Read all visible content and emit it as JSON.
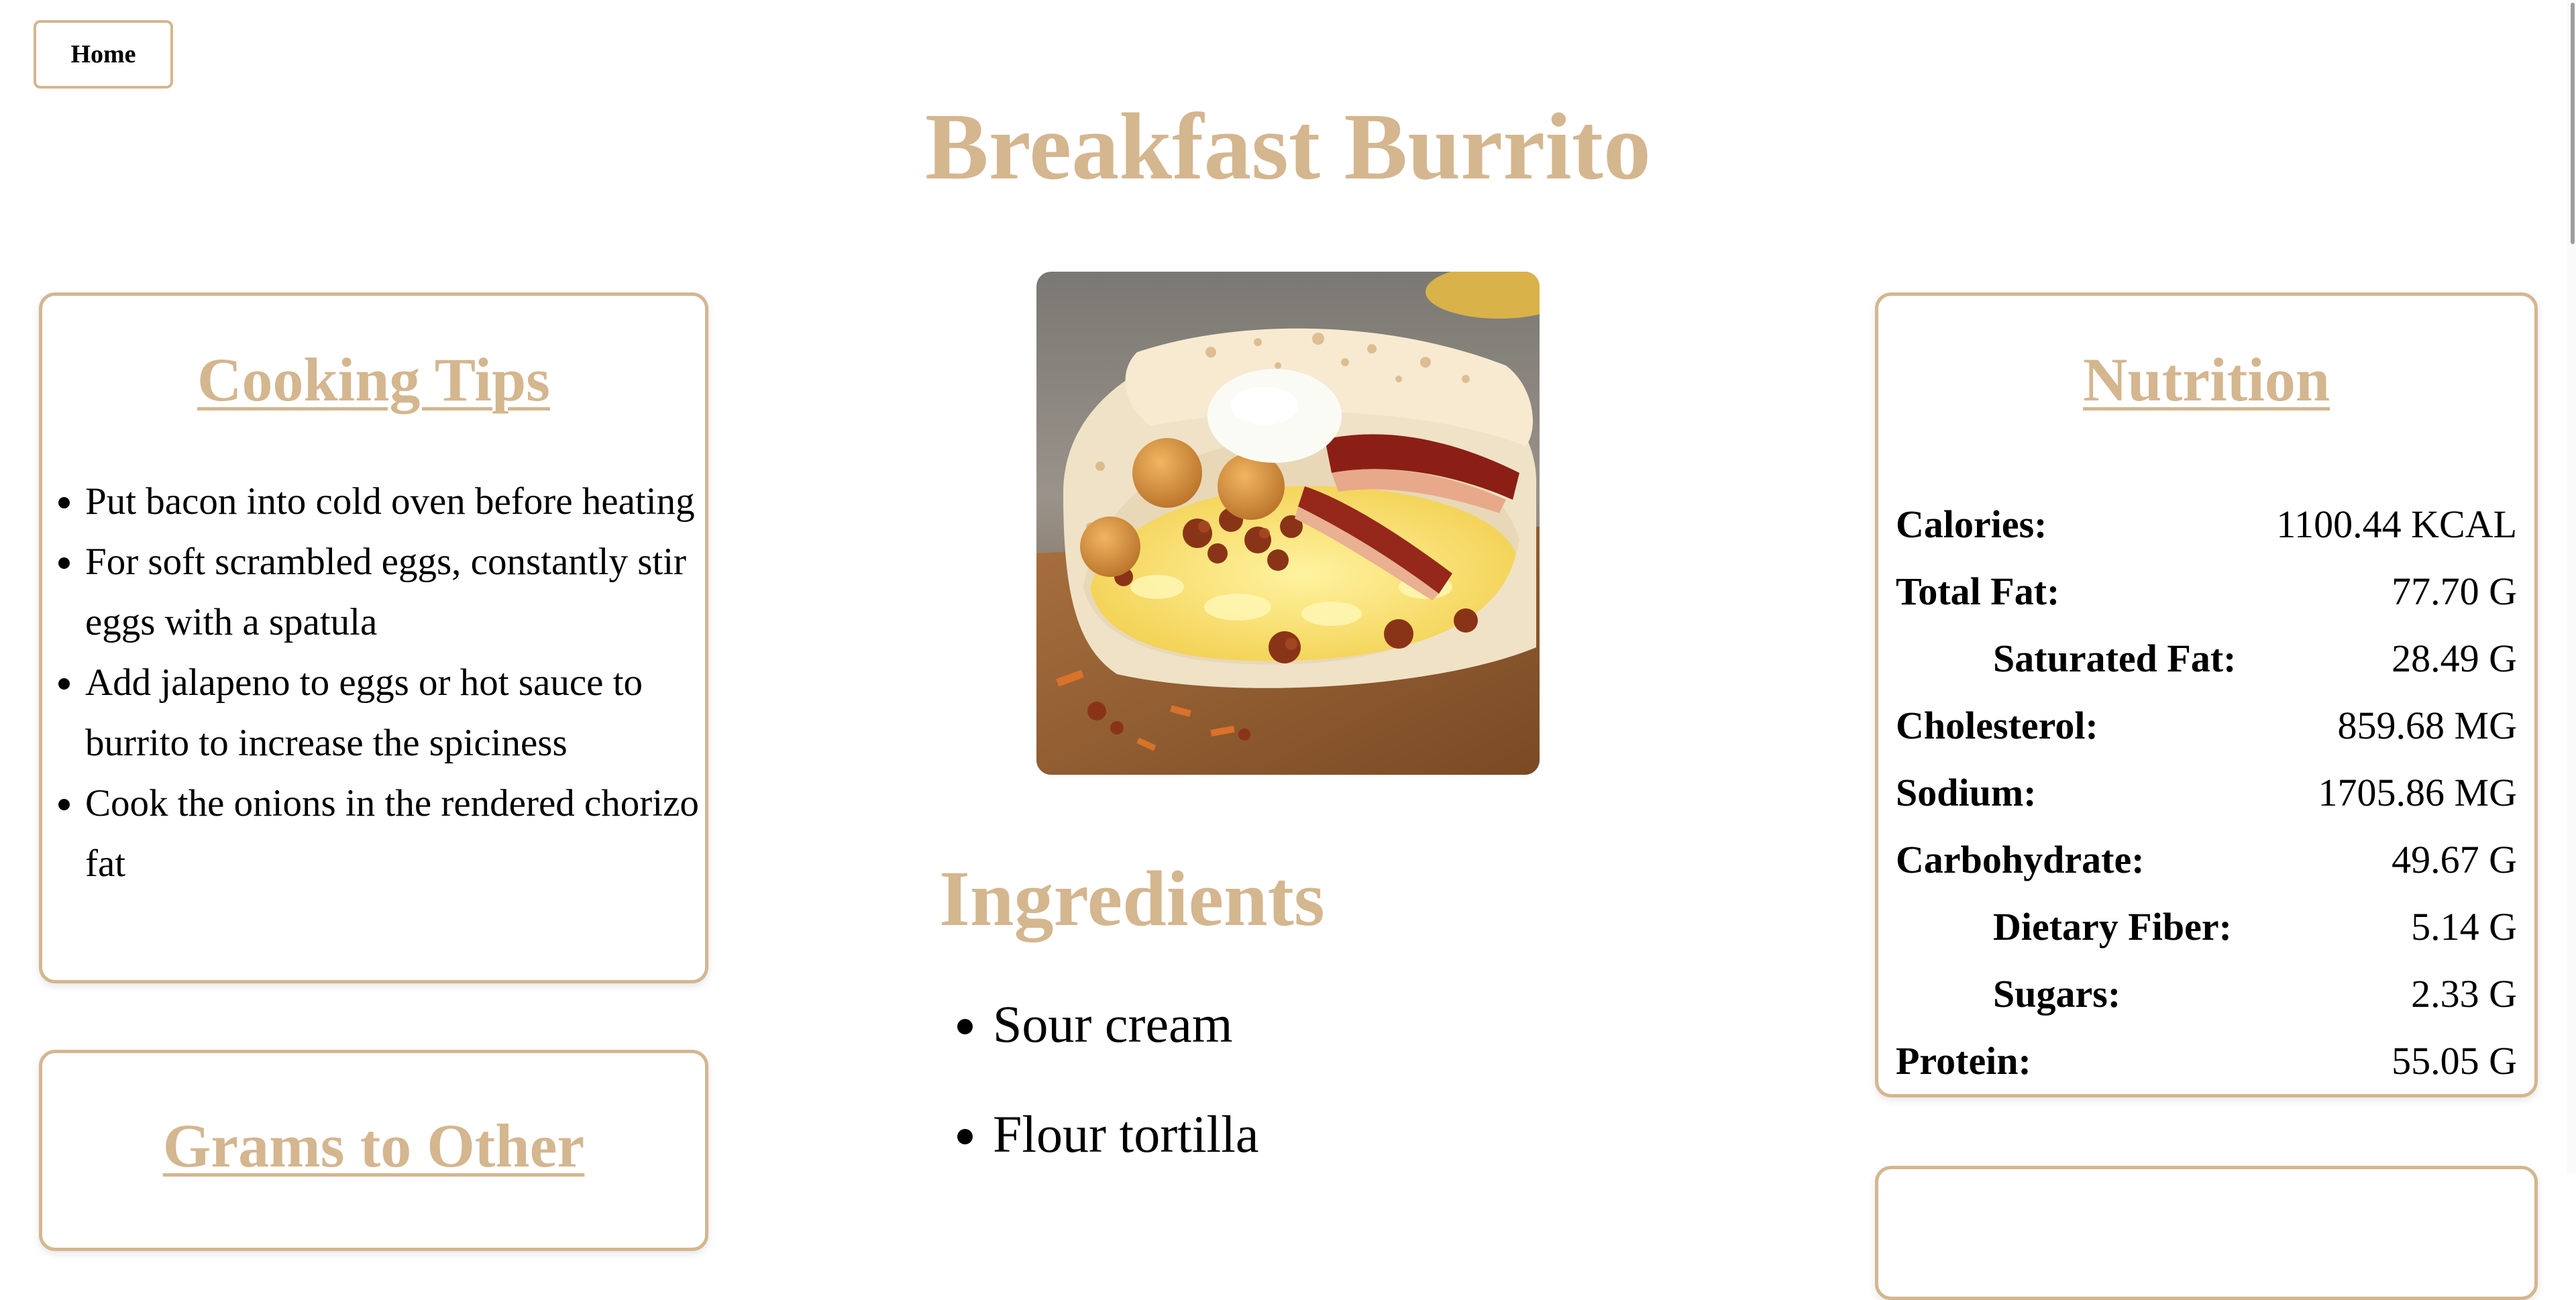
{
  "nav": {
    "home_label": "Home"
  },
  "recipe": {
    "title": "Breakfast Burrito"
  },
  "cooking_tips": {
    "title": "Cooking Tips",
    "items": [
      "Put bacon into cold oven before heating",
      "For soft scrambled eggs, constantly stir eggs with a spatula",
      "Add jalapeno to eggs or hot sauce to burrito to increase the spiciness",
      "Cook the onions in the rendered chorizo fat"
    ]
  },
  "grams_card": {
    "title": "Grams to Other"
  },
  "ingredients": {
    "title": "Ingredients",
    "items": [
      "Sour cream",
      "Flour tortilla"
    ]
  },
  "nutrition": {
    "title": "Nutrition",
    "rows": [
      {
        "label": "Calories:",
        "value": "1100.44 KCAL"
      },
      {
        "label": "Total Fat:",
        "value": "77.70 G"
      },
      {
        "label": "Saturated Fat:",
        "value": "28.49 G"
      },
      {
        "label": "Cholesterol:",
        "value": "859.68 MG"
      },
      {
        "label": "Sodium:",
        "value": "1705.86 MG"
      },
      {
        "label": "Carbohydrate:",
        "value": "49.67 G"
      },
      {
        "label": "Dietary Fiber:",
        "value": "5.14 G"
      },
      {
        "label": "Sugars:",
        "value": "2.33 G"
      },
      {
        "label": "Protein:",
        "value": "55.05 G"
      }
    ]
  },
  "colors": {
    "accent": "#d4b68f",
    "text": "#000000",
    "background": "#ffffff"
  }
}
